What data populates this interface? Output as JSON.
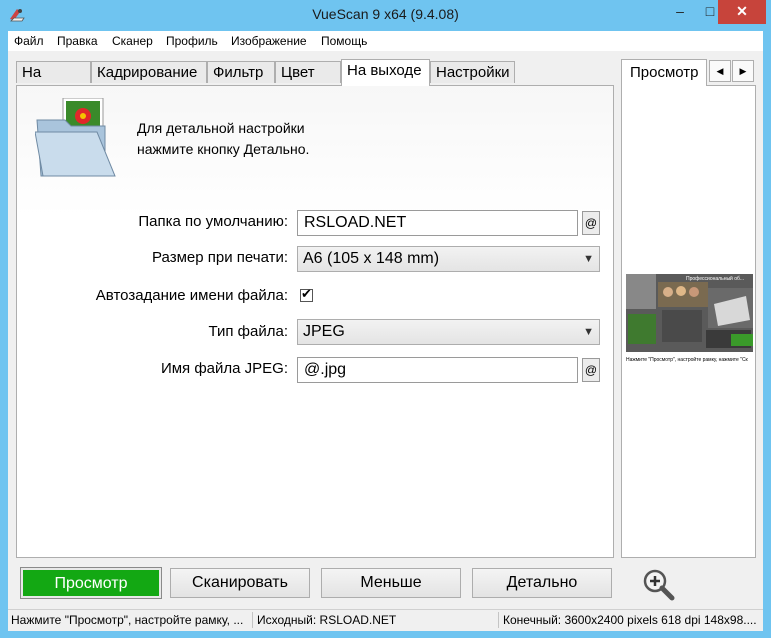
{
  "window": {
    "title": "VueScan 9 x64 (9.4.08)",
    "minimize": "–",
    "maximize": "□",
    "close": "✕"
  },
  "menu": [
    "Файл",
    "Правка",
    "Сканер",
    "Профиль",
    "Изображение",
    "Помощь"
  ],
  "tabs": [
    "На входе",
    "Кадрирование",
    "Фильтр",
    "Цвет",
    "На выходе",
    "Настройки"
  ],
  "active_tab": "На выходе",
  "info": {
    "line1": "Для детальной настройки",
    "line2": "нажмите кнопку Детально."
  },
  "fields": {
    "folder_label": "Папка по умолчанию:",
    "folder_value": "RSLOAD.NET",
    "print_size_label": "Размер при печати:",
    "print_size_value": "A6 (105 x 148 mm)",
    "auto_name_label": "Автозадание имени файла:",
    "auto_name_checked": true,
    "file_type_label": "Тип файла:",
    "file_type_value": "JPEG",
    "jpeg_name_label": "Имя файла JPEG:",
    "jpeg_name_value": "@.jpg",
    "at_button": "@"
  },
  "preview": {
    "tab_label": "Просмотр",
    "prev_icon": "chevron-left-icon",
    "next_icon": "chevron-right-icon",
    "thumb_title": "Профессиональный об...",
    "thumb_caption": "Нажмите \"Просмотр\", настройте рамку, нажмите \"Ск"
  },
  "buttons": {
    "preview": "Просмотр",
    "scan": "Сканировать",
    "less": "Меньше",
    "detail": "Детально"
  },
  "status": {
    "left": "Нажмите \"Просмотр\", настройте рамку, ...",
    "middle": "Исходный: RSLOAD.NET",
    "right": "Конечный: 3600x2400 pixels 618 dpi 148x98...."
  },
  "colors": {
    "titlebar": "#6fc4f0",
    "close": "#c7443b",
    "preview_button": "#13a813"
  }
}
